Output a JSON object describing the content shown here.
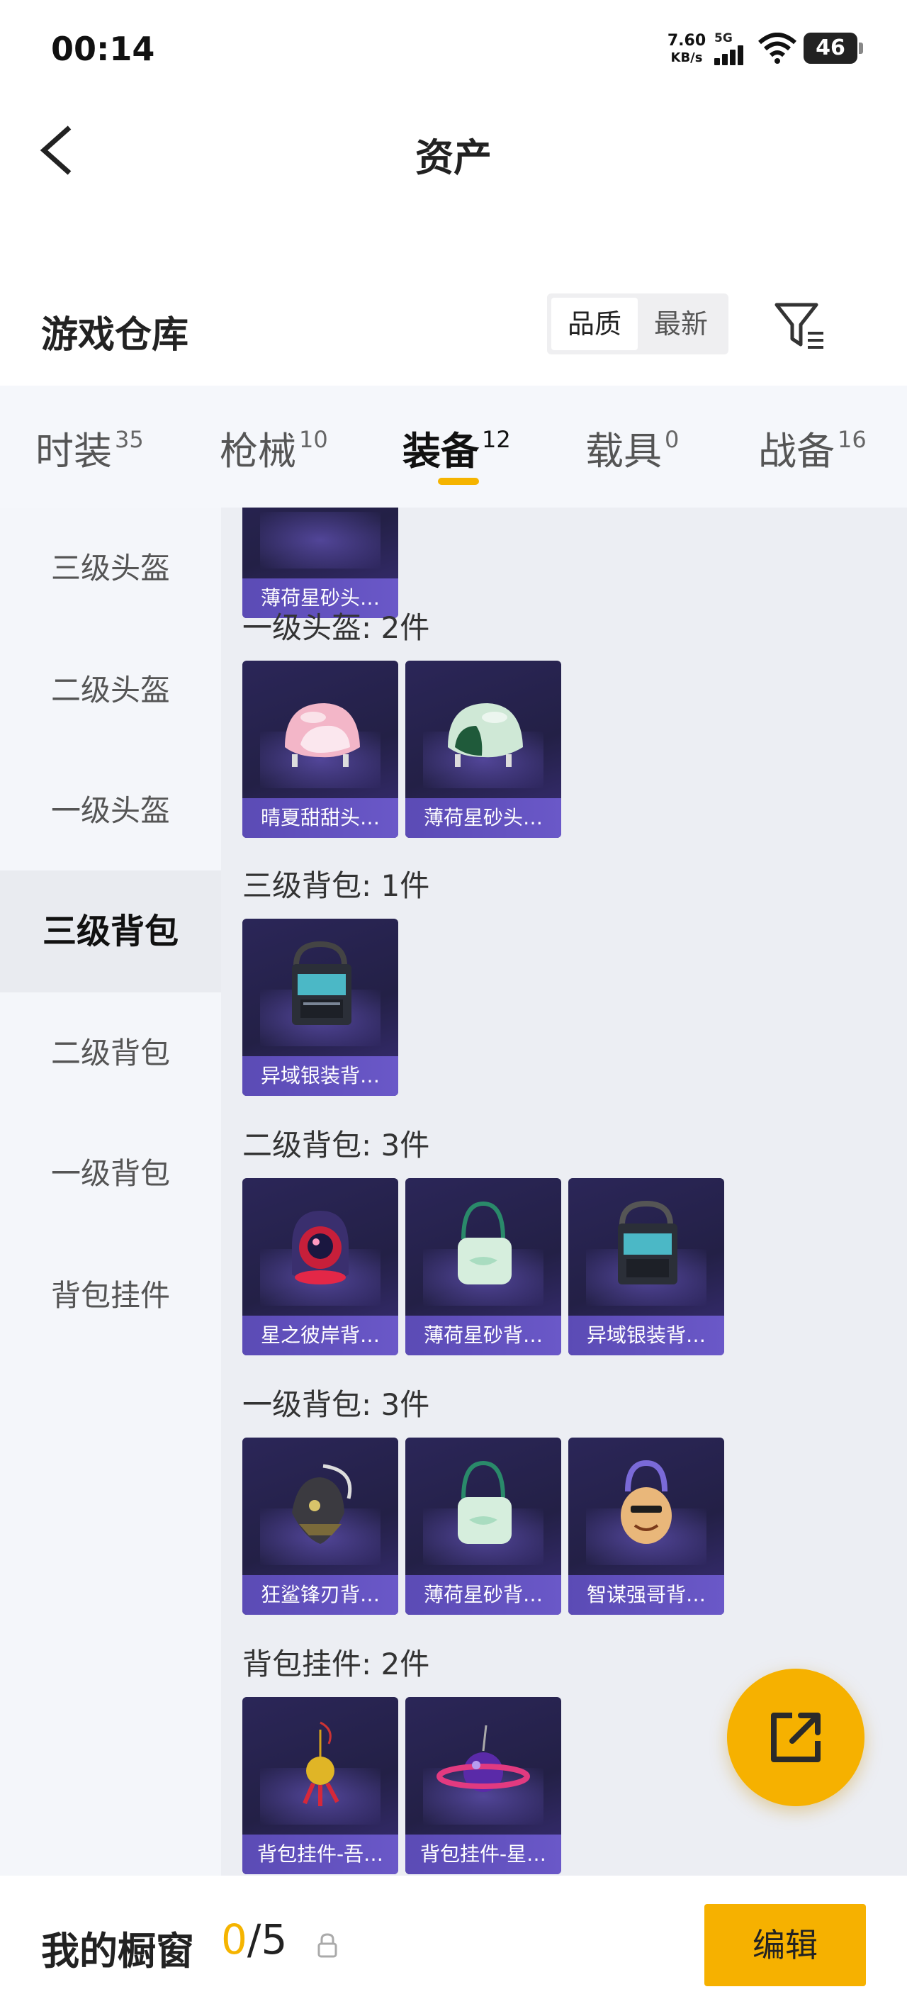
{
  "status": {
    "time": "00:14",
    "net_speed": "7.60",
    "net_unit": "KB/s",
    "network": "5G",
    "battery": "46"
  },
  "header": {
    "title": "资产"
  },
  "section": {
    "title": "游戏仓库",
    "sort_options": [
      "品质",
      "最新"
    ],
    "active_sort": "品质"
  },
  "tabs": [
    {
      "label": "时装",
      "count": "35"
    },
    {
      "label": "枪械",
      "count": "10"
    },
    {
      "label": "装备",
      "count": "12",
      "active": true
    },
    {
      "label": "载具",
      "count": "0"
    },
    {
      "label": "战备",
      "count": "16"
    }
  ],
  "sidebar": {
    "items": [
      "三级头盔",
      "二级头盔",
      "一级头盔",
      "三级背包",
      "二级背包",
      "一级背包",
      "背包挂件"
    ],
    "active": "三级背包"
  },
  "groups": [
    {
      "label": "",
      "items": [
        "薄荷星砂头…"
      ]
    },
    {
      "label": "一级头盔: 2件",
      "items": [
        "晴夏甜甜头…",
        "薄荷星砂头…"
      ]
    },
    {
      "label": "三级背包: 1件",
      "items": [
        "异域银装背…"
      ]
    },
    {
      "label": "二级背包: 3件",
      "items": [
        "星之彼岸背…",
        "薄荷星砂背…",
        "异域银装背…"
      ]
    },
    {
      "label": "一级背包: 3件",
      "items": [
        "狂鲨锋刃背…",
        "薄荷星砂背…",
        "智谋强哥背…"
      ]
    },
    {
      "label": "背包挂件: 2件",
      "items": [
        "背包挂件-吾…",
        "背包挂件-星…"
      ]
    }
  ],
  "showcase": {
    "label": "我的橱窗",
    "current": "0",
    "total": "/5",
    "edit_label": "编辑"
  },
  "colors": {
    "accent": "#f5b400",
    "card_bg": "#2b2658",
    "card_label": "#5b4bb5"
  }
}
